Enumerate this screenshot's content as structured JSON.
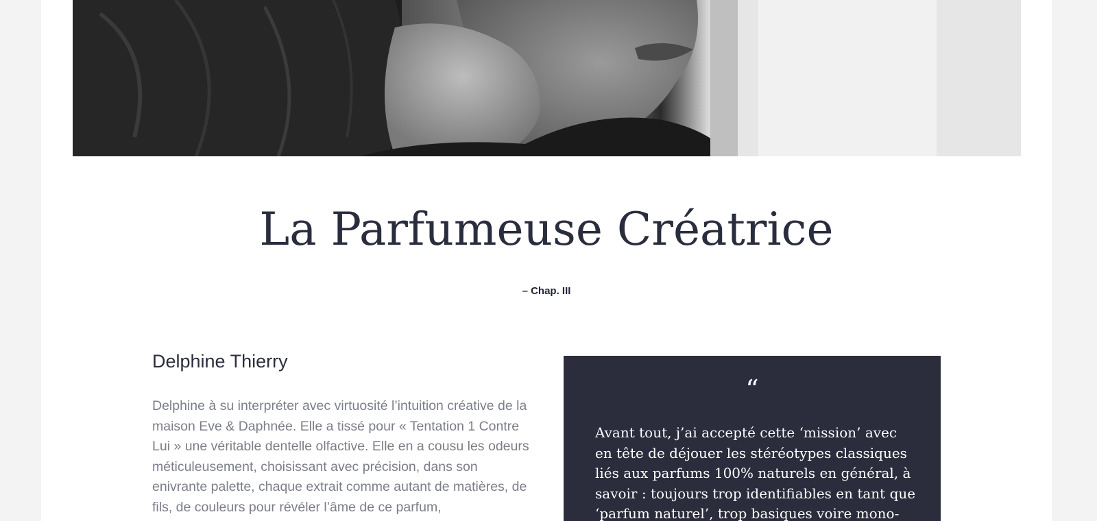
{
  "hero": {
    "alt": "Black and white portrait photo"
  },
  "article": {
    "title": "La Parfumeuse Créatrice",
    "chapter": "– Chap. III",
    "author": "Delphine Thierry",
    "bio": "Delphine à su interpréter avec virtuosité l’intuition créative de la maison Eve & Daphnée. Elle a tissé pour « Tentation 1 Contre Lui » une véritable dentelle olfactive. Elle en a cousu les odeurs méticuleusement, choisissant avec précision, dans son enivrante palette, chaque extrait comme autant de matières, de fils, de couleurs pour révéler l’âme de ce parfum,",
    "quote_mark": "“",
    "quote": "Avant tout, j’ai accepté cette ‘mission’ avec en tête de déjouer les stéréotypes classiques liés aux parfums 100% naturels en général, à savoir : toujours trop identifiables en tant que ‘parfum naturel’, trop basiques voire mono-senteur,"
  },
  "colors": {
    "background": "#f3f3f3",
    "page": "#ffffff",
    "heading": "#2a2d3d",
    "body_text": "#7b7e88",
    "quote_box": "#2b2d3d"
  }
}
